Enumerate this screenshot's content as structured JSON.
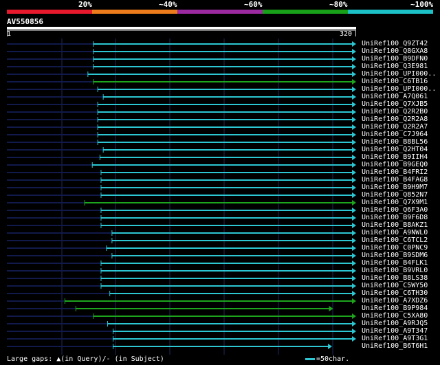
{
  "scale": {
    "segments": [
      {
        "color": "#e8192c"
      },
      {
        "color": "#ec7c1c"
      },
      {
        "color": "#9c2aa0"
      },
      {
        "color": "#19a019"
      },
      {
        "color": "#1cc1c7"
      }
    ],
    "labels": [
      "20%",
      "~40%",
      "~60%",
      "~80%",
      "~100%"
    ]
  },
  "query": {
    "name": "AV550856",
    "start": "1",
    "end": "320"
  },
  "colors": {
    "cyan": "#2cc7d3",
    "green": "#1ea51e",
    "dim": "#111a4a",
    "grid": "#1c2a5a"
  },
  "hits": [
    {
      "label": "UniRef100_Q9ZT42",
      "start": 80,
      "end": 320,
      "color": "cyan"
    },
    {
      "label": "UniRef100_Q8GXA8",
      "start": 80,
      "end": 320,
      "color": "cyan"
    },
    {
      "label": "UniRef100_B9DFN0",
      "start": 80,
      "end": 320,
      "color": "cyan"
    },
    {
      "label": "UniRef100_Q3E981",
      "start": 80,
      "end": 320,
      "color": "cyan"
    },
    {
      "label": "UniRef100_UPI000..",
      "start": 75,
      "end": 320,
      "color": "cyan"
    },
    {
      "label": "UniRef100_C6TB16",
      "start": 80,
      "end": 320,
      "color": "green"
    },
    {
      "label": "UniRef100_UPI000..",
      "start": 84,
      "end": 320,
      "color": "cyan"
    },
    {
      "label": "UniRef100_A7Q061",
      "start": 89,
      "end": 320,
      "color": "cyan"
    },
    {
      "label": "UniRef100_Q7XJB5",
      "start": 84,
      "end": 320,
      "color": "cyan"
    },
    {
      "label": "UniRef100_Q2R2B0",
      "start": 84,
      "end": 320,
      "color": "cyan"
    },
    {
      "label": "UniRef100_Q2R2A8",
      "start": 84,
      "end": 320,
      "color": "cyan"
    },
    {
      "label": "UniRef100_Q2R2A7",
      "start": 84,
      "end": 320,
      "color": "cyan"
    },
    {
      "label": "UniRef100_C7J964",
      "start": 84,
      "end": 320,
      "color": "cyan"
    },
    {
      "label": "UniRef100_B8BL56",
      "start": 84,
      "end": 320,
      "color": "cyan"
    },
    {
      "label": "UniRef100_Q2HT04",
      "start": 89,
      "end": 320,
      "color": "cyan"
    },
    {
      "label": "UniRef100_B9IIH4",
      "start": 86,
      "end": 320,
      "color": "cyan"
    },
    {
      "label": "UniRef100_B9GEQ0",
      "start": 79,
      "end": 320,
      "color": "cyan"
    },
    {
      "label": "UniRef100_B4FRI2",
      "start": 87,
      "end": 320,
      "color": "cyan"
    },
    {
      "label": "UniRef100_B4FAG8",
      "start": 87,
      "end": 320,
      "color": "cyan"
    },
    {
      "label": "UniRef100_B9H9M7",
      "start": 87,
      "end": 320,
      "color": "cyan"
    },
    {
      "label": "UniRef100_Q852N7",
      "start": 87,
      "end": 320,
      "color": "cyan"
    },
    {
      "label": "UniRef100_Q7X9M1",
      "start": 72,
      "end": 320,
      "color": "green"
    },
    {
      "label": "UniRef100_Q6F3A0",
      "start": 87,
      "end": 320,
      "color": "cyan"
    },
    {
      "label": "UniRef100_B9F6D8",
      "start": 87,
      "end": 320,
      "color": "cyan"
    },
    {
      "label": "UniRef100_B8AKZ1",
      "start": 87,
      "end": 320,
      "color": "cyan"
    },
    {
      "label": "UniRef100_A9NWL0",
      "start": 97,
      "end": 320,
      "color": "cyan"
    },
    {
      "label": "UniRef100_C6TCL2",
      "start": 97,
      "end": 320,
      "color": "cyan"
    },
    {
      "label": "UniRef100_C0PNC9",
      "start": 92,
      "end": 320,
      "color": "cyan"
    },
    {
      "label": "UniRef100_B9SDM6",
      "start": 97,
      "end": 320,
      "color": "cyan"
    },
    {
      "label": "UniRef100_B4FLK1",
      "start": 87,
      "end": 320,
      "color": "cyan"
    },
    {
      "label": "UniRef100_B9VRL0",
      "start": 87,
      "end": 320,
      "color": "cyan"
    },
    {
      "label": "UniRef100_B8LS38",
      "start": 87,
      "end": 320,
      "color": "cyan"
    },
    {
      "label": "UniRef100_C5WY50",
      "start": 87,
      "end": 320,
      "color": "cyan"
    },
    {
      "label": "UniRef100_C6TH30",
      "start": 95,
      "end": 320,
      "color": "cyan"
    },
    {
      "label": "UniRef100_A7XDZ6",
      "start": 54,
      "end": 320,
      "color": "green"
    },
    {
      "label": "UniRef100_B9P984",
      "start": 64,
      "end": 299,
      "color": "green"
    },
    {
      "label": "UniRef100_C5XA80",
      "start": 80,
      "end": 320,
      "color": "green"
    },
    {
      "label": "UniRef100_A9RJQ5",
      "start": 93,
      "end": 320,
      "color": "cyan"
    },
    {
      "label": "UniRef100_A9T347",
      "start": 98,
      "end": 320,
      "color": "cyan"
    },
    {
      "label": "UniRef100_A9T3G1",
      "start": 98,
      "end": 320,
      "color": "cyan"
    },
    {
      "label": "UniRef100_B6T6H1",
      "start": 98,
      "end": 298,
      "color": "cyan"
    }
  ],
  "legend": {
    "left": "Large gaps: ▲(in Query)/- (in Subject)",
    "right": "=50char."
  }
}
